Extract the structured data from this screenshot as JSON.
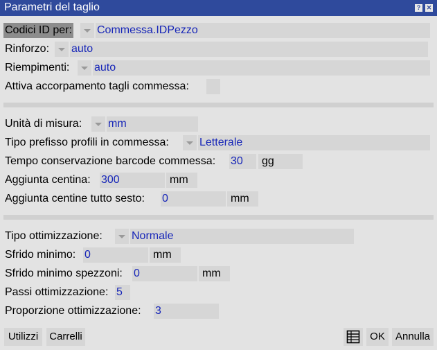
{
  "window": {
    "title": "Parametri del taglio"
  },
  "section1": {
    "codici_label": "Codici ID per:",
    "codici_value": "Commessa.IDPezzo",
    "rinforzo_label": "Rinforzo:",
    "rinforzo_value": "auto",
    "riempimenti_label": "Riempimenti:",
    "riempimenti_value": "auto",
    "accorpamento_label": "Attiva accorpamento tagli commessa:"
  },
  "section2": {
    "unita_label": "Unità di misura:",
    "unita_value": "mm",
    "prefisso_label": "Tipo prefisso profili in commessa:",
    "prefisso_value": "Letterale",
    "barcode_label": "Tempo conservazione barcode commessa:",
    "barcode_value": "30",
    "barcode_unit": "gg",
    "centina_label": "Aggiunta centina:",
    "centina_value": "300",
    "centina_unit": "mm",
    "sesto_label": "Aggiunta centine tutto sesto:",
    "sesto_value": "0",
    "sesto_unit": "mm"
  },
  "section3": {
    "ottim_label": "Tipo ottimizzazione:",
    "ottim_value": "Normale",
    "sfrido_label": "Sfrido minimo:",
    "sfrido_value": "0",
    "sfrido_unit": "mm",
    "spezzoni_label": "Sfrido minimo spezzoni:",
    "spezzoni_value": "0",
    "spezzoni_unit": "mm",
    "passi_label": "Passi ottimizzazione:",
    "passi_value": "5",
    "proporzione_label": "Proporzione ottimizzazione:",
    "proporzione_value": "3"
  },
  "footer": {
    "utilizzi": "Utilizzi",
    "carrelli": "Carrelli",
    "grid_icon": "table-icon",
    "ok": "OK",
    "annulla": "Annulla"
  }
}
